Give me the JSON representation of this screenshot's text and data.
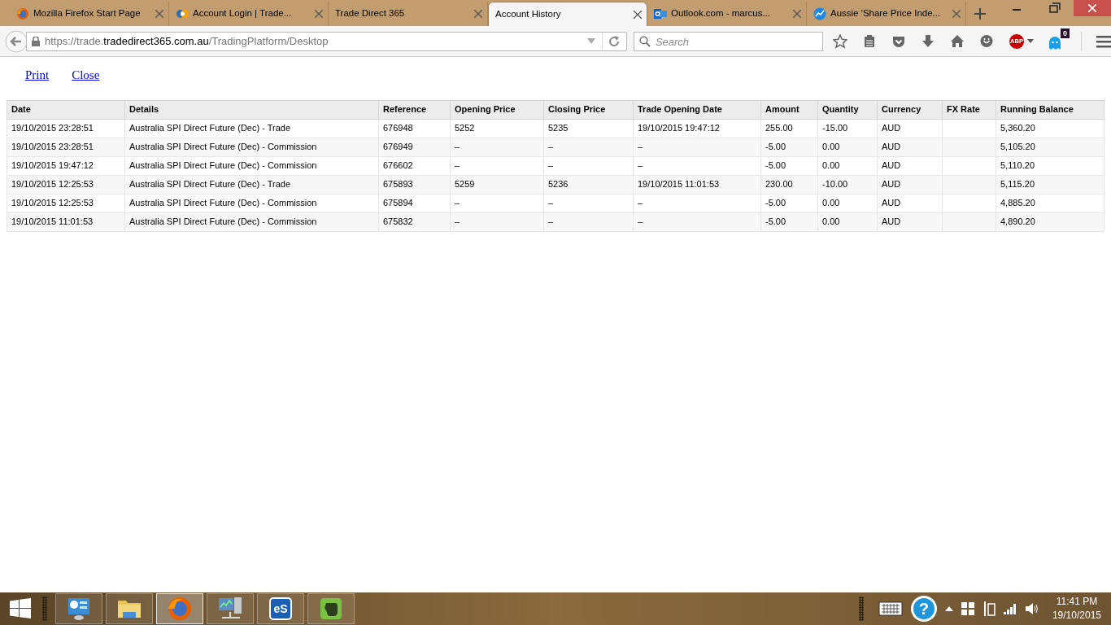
{
  "tabs": [
    {
      "label": "Mozilla Firefox Start Page",
      "selected": false,
      "kind": "firefox"
    },
    {
      "label": "Account Login | Trade...",
      "selected": false,
      "kind": "login"
    },
    {
      "label": "Trade Direct 365",
      "selected": false,
      "kind": "plain"
    },
    {
      "label": "Account History",
      "selected": true,
      "kind": "plain"
    },
    {
      "label": "Outlook.com - marcus...",
      "selected": false,
      "kind": "mail"
    },
    {
      "label": "Aussie 'Share Price Inde...",
      "selected": false,
      "kind": "chart"
    }
  ],
  "address": {
    "scheme": "https://trade.",
    "domain": "tradedirect365.com.au",
    "path": "/TradingPlatform/Desktop"
  },
  "search": {
    "placeholder": "Search"
  },
  "adblock_label": "ABP",
  "notification_count": "0",
  "links": [
    "Print",
    "Close"
  ],
  "table": {
    "columns": [
      "Date",
      "Details",
      "Reference",
      "Opening Price",
      "Closing Price",
      "Trade Opening Date",
      "Amount",
      "Quantity",
      "Currency",
      "FX Rate",
      "Running Balance"
    ],
    "rows": [
      [
        "19/10/2015 23:28:51",
        "Australia SPI Direct Future (Dec) - Trade",
        "676948",
        "5252",
        "5235",
        "19/10/2015 19:47:12",
        "255.00",
        "-15.00",
        "AUD",
        "",
        "5,360.20"
      ],
      [
        "19/10/2015 23:28:51",
        "Australia SPI Direct Future (Dec) - Commission",
        "676949",
        "–",
        "–",
        "–",
        "-5.00",
        "0.00",
        "AUD",
        "",
        "5,105.20"
      ],
      [
        "19/10/2015 19:47:12",
        "Australia SPI Direct Future (Dec) - Commission",
        "676602",
        "–",
        "–",
        "–",
        "-5.00",
        "0.00",
        "AUD",
        "",
        "5,110.20"
      ],
      [
        "19/10/2015 12:25:53",
        "Australia SPI Direct Future (Dec) - Trade",
        "675893",
        "5259",
        "5236",
        "19/10/2015 11:01:53",
        "230.00",
        "-10.00",
        "AUD",
        "",
        "5,115.20"
      ],
      [
        "19/10/2015 12:25:53",
        "Australia SPI Direct Future (Dec) - Commission",
        "675894",
        "–",
        "–",
        "–",
        "-5.00",
        "0.00",
        "AUD",
        "",
        "4,885.20"
      ],
      [
        "19/10/2015 11:01:53",
        "Australia SPI Direct Future (Dec) - Commission",
        "675832",
        "–",
        "–",
        "–",
        "-5.00",
        "0.00",
        "AUD",
        "",
        "4,890.20"
      ]
    ]
  },
  "taskbar": {
    "apps": [
      {
        "kind": "control-panel",
        "selected": false
      },
      {
        "kind": "folder",
        "selected": false
      },
      {
        "kind": "firefox",
        "selected": true
      },
      {
        "kind": "network",
        "selected": false
      },
      {
        "kind": "es",
        "label": "eS",
        "selected": false
      },
      {
        "kind": "evernote",
        "selected": false
      }
    ],
    "help_glyph": "?",
    "time": "11:41 PM",
    "date": "19/10/2015"
  }
}
